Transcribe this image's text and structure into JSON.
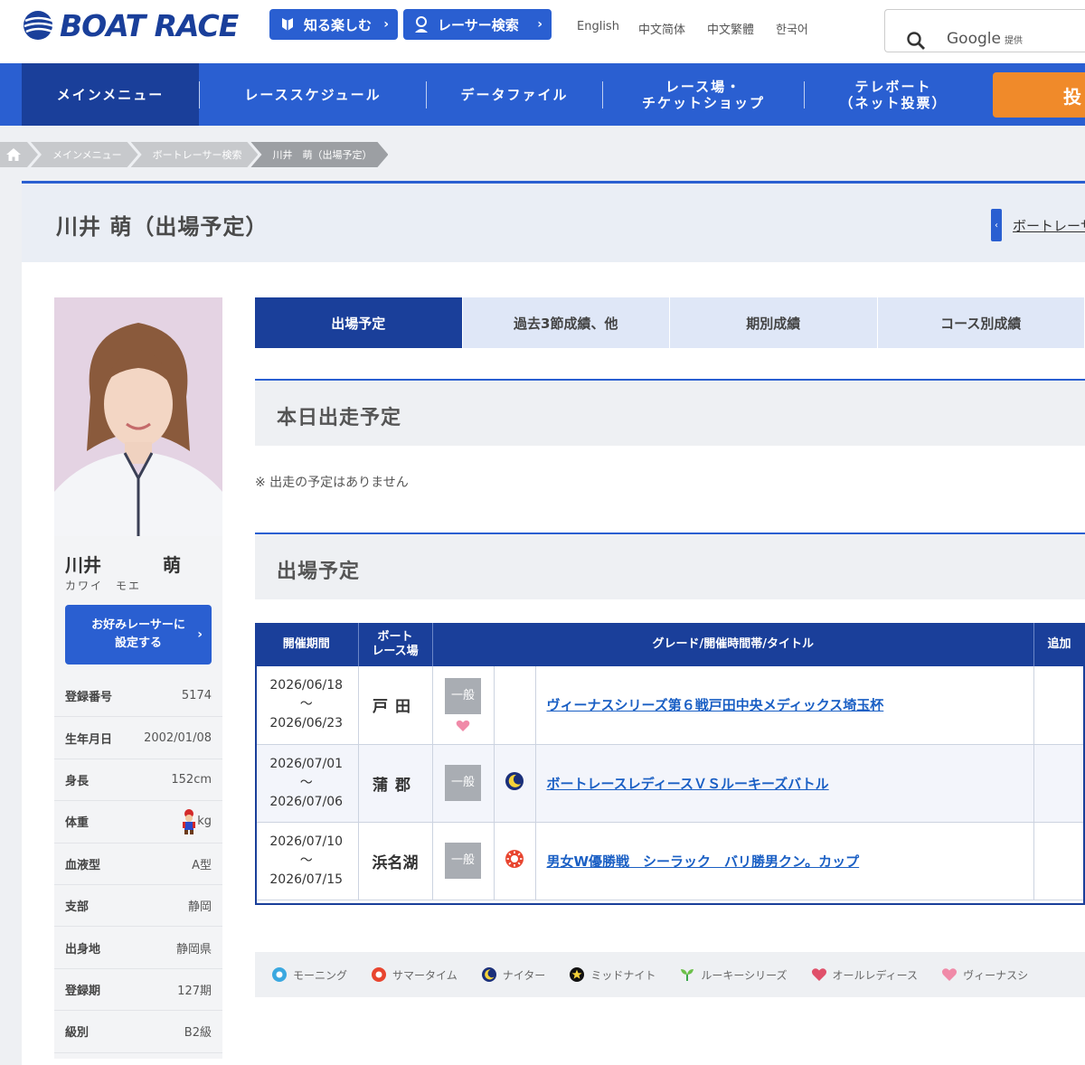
{
  "header": {
    "logo_text": "BOAT RACE",
    "pill_1": "知る楽しむ",
    "pill_2": "レーサー検索",
    "langs": [
      "English",
      "中文简体",
      "中文繁體",
      "한국어"
    ],
    "search_provider": "Google",
    "search_provider_suffix": "提供"
  },
  "nav": {
    "items": [
      "メインメニュー",
      "レーススケジュール",
      "データファイル",
      "レース場・\nチケットショップ",
      "テレボート\n（ネット投票）"
    ],
    "vote_label": "投"
  },
  "breadcrumb": [
    "メインメニュー",
    "ボートレーサー検索",
    "川井　萌（出場予定）"
  ],
  "page": {
    "title": "川井 萌（出場予定）",
    "back_link": "ボートレーサー検索"
  },
  "racer": {
    "last_name": "川井",
    "first_name": "萌",
    "kana": "カワイ　モエ",
    "fav_button": "お好みレーサーに\n設定する",
    "info": [
      {
        "label": "登録番号",
        "value": "5174"
      },
      {
        "label": "生年月日",
        "value": "2002/01/08"
      },
      {
        "label": "身長",
        "value": "152cm"
      },
      {
        "label": "体重",
        "value": "kg"
      },
      {
        "label": "血液型",
        "value": "A型"
      },
      {
        "label": "支部",
        "value": "静岡"
      },
      {
        "label": "出身地",
        "value": "静岡県"
      },
      {
        "label": "登録期",
        "value": "127期"
      },
      {
        "label": "級別",
        "value": "B2級"
      }
    ]
  },
  "tabs": [
    "出場予定",
    "過去3節成績、他",
    "期別成績",
    "コース別成績"
  ],
  "today": {
    "heading": "本日出走予定",
    "empty": "※ 出走の予定はありません"
  },
  "upcoming": {
    "heading": "出場予定",
    "columns": [
      "開催期間",
      "ボート\nレース場",
      "グレード/開催時間帯/タイトル",
      "追加"
    ],
    "rows": [
      {
        "start": "2026/06/18",
        "tilde": "〜",
        "end": "2026/06/23",
        "venue": "戸田",
        "grade": "一般",
        "time_icon": "",
        "extra_icon": "venus-heart",
        "title": "ヴィーナスシリーズ第６戦戸田中央メディックス埼玉杯"
      },
      {
        "start": "2026/07/01",
        "tilde": "〜",
        "end": "2026/07/06",
        "venue": "蒲郡",
        "grade": "一般",
        "time_icon": "nighter-moon",
        "extra_icon": "",
        "title": "ボートレースレディースＶＳルーキーズバトル"
      },
      {
        "start": "2026/07/10",
        "tilde": "〜",
        "end": "2026/07/15",
        "venue": "浜名湖",
        "grade": "一般",
        "time_icon": "summer-sun",
        "extra_icon": "",
        "title": "男女W優勝戦　シーラック　バリ勝男クン。カップ"
      }
    ]
  },
  "legend": [
    {
      "icon": "morning",
      "label": "モーニング"
    },
    {
      "icon": "summer",
      "label": "サマータイム"
    },
    {
      "icon": "nighter",
      "label": "ナイター"
    },
    {
      "icon": "midnight",
      "label": "ミッドナイト"
    },
    {
      "icon": "rookie",
      "label": "ルーキーシリーズ"
    },
    {
      "icon": "all-ladies",
      "label": "オールレディース"
    },
    {
      "icon": "venus",
      "label": "ヴィーナスシ"
    }
  ],
  "colors": {
    "primary": "#2a5fd1",
    "dark": "#1a3f9a",
    "accent": "#f08a2a",
    "link": "#1a5fc4"
  }
}
